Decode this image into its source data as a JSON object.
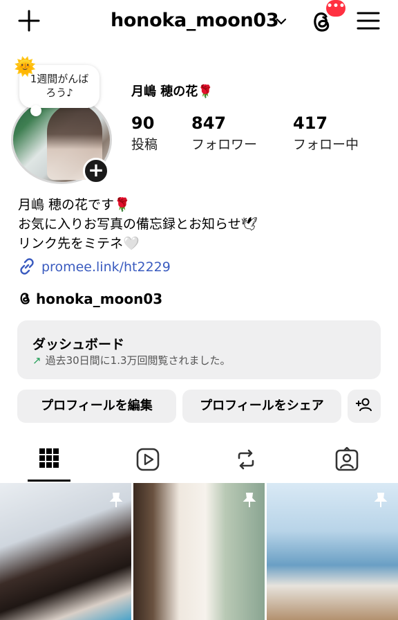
{
  "header": {
    "username": "honoka_moon03",
    "notification_badge": "•••",
    "icons": [
      "plus-icon",
      "chevron-down-icon",
      "threads-icon",
      "menu-icon"
    ]
  },
  "profile": {
    "note": "1週間がんば\nろう♪",
    "note_emoji": "🌞",
    "display_name": "月嶋 穂の花🌹",
    "stats": [
      {
        "value": "90",
        "label": "投稿"
      },
      {
        "value": "847",
        "label": "フォロワー"
      },
      {
        "value": "417",
        "label": "フォロー中"
      }
    ],
    "bio_lines": [
      "月嶋 穂の花です🌹",
      "お気に入りお写真の備忘録とお知らせ🕊",
      "リンク先をミテネ🤍"
    ],
    "link": "promee.link/ht2229",
    "threads_handle": "honoka_moon03"
  },
  "dashboard": {
    "title": "ダッシュボード",
    "arrow": "↗",
    "subtitle": "過去30日間に1.3万回閲覧されました。"
  },
  "buttons": {
    "edit_profile": "プロフィールを編集",
    "share_profile": "プロフィールをシェア"
  },
  "tabs": [
    "grid-icon",
    "reels-icon",
    "reposts-icon",
    "tagged-icon"
  ],
  "active_tab": 0,
  "colors": {
    "accent_link": "#3a5bbf",
    "badge": "#ff3040",
    "dash_arrow": "#1f9d55"
  }
}
